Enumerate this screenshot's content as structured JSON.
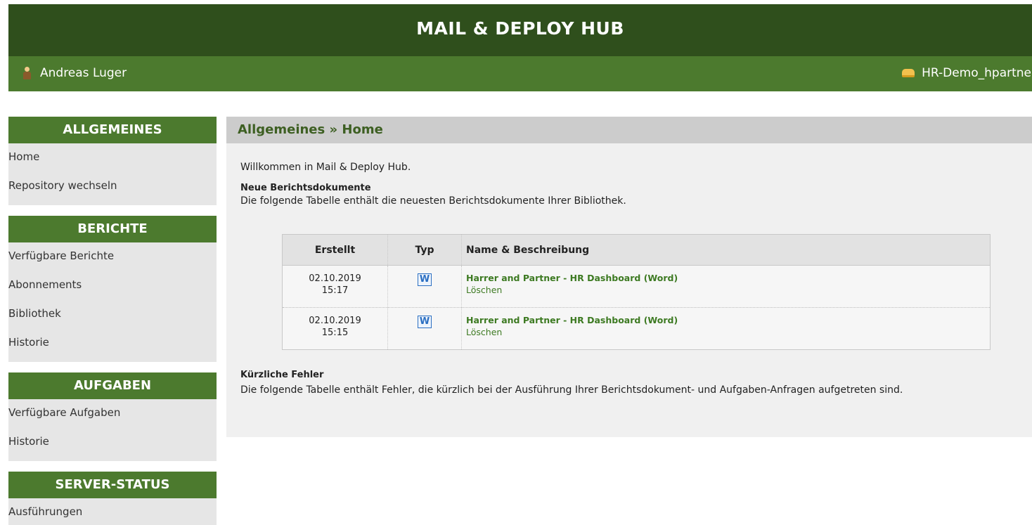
{
  "app": {
    "title": "MAIL & DEPLOY HUB"
  },
  "userbar": {
    "user_name": "Andreas Luger",
    "repository": "HR-Demo_hpartner"
  },
  "sidebar": {
    "sections": [
      {
        "title": "ALLGEMEINES",
        "items": [
          "Home",
          "Repository wechseln"
        ]
      },
      {
        "title": "BERICHTE",
        "items": [
          "Verfügbare Berichte",
          "Abonnements",
          "Bibliothek",
          "Historie"
        ]
      },
      {
        "title": "AUFGABEN",
        "items": [
          "Verfügbare Aufgaben",
          "Historie"
        ]
      },
      {
        "title": "SERVER-STATUS",
        "items": [
          "Ausführungen"
        ]
      }
    ]
  },
  "main": {
    "breadcrumb": "Allgemeines » Home",
    "welcome": "Willkommen in Mail & Deploy Hub.",
    "reports_section": {
      "title": "Neue Berichtsdokumente",
      "description": "Die folgende Tabelle enthält die neuesten Berichtsdokumente Ihrer Bibliothek."
    },
    "table": {
      "headers": {
        "created": "Erstellt",
        "type": "Typ",
        "name": "Name & Beschreibung"
      },
      "rows": [
        {
          "date": "02.10.2019",
          "time": "15:17",
          "type_icon": "W",
          "name": "Harrer and Partner - HR Dashboard (Word)",
          "action": "Löschen"
        },
        {
          "date": "02.10.2019",
          "time": "15:15",
          "type_icon": "W",
          "name": "Harrer and Partner - HR Dashboard (Word)",
          "action": "Löschen"
        }
      ]
    },
    "errors_section": {
      "title": "Kürzliche Fehler",
      "description": "Die folgende Tabelle enthält Fehler, die kürzlich bei der Ausführung Ihrer Berichtsdokument- und Aufgaben-Anfragen aufgetreten sind."
    }
  },
  "colors": {
    "header_dark": "#2f4f1c",
    "header_green": "#4c7a2e",
    "link_green": "#3d7a22",
    "word_blue": "#2b6fc2"
  }
}
